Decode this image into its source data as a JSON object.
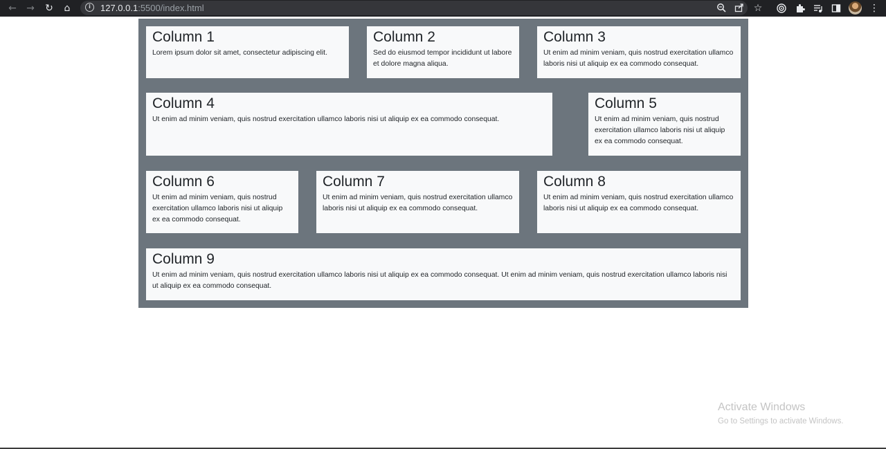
{
  "browser": {
    "url_host": "127.0.0.1",
    "url_rest": ":5500/index.html",
    "icons": [
      "back-arrow-icon",
      "forward-arrow-icon",
      "reload-icon",
      "home-icon",
      "site-info-icon",
      "zoom-icon",
      "share-icon",
      "bookmark-star-icon",
      "extension-target-icon",
      "extensions-puzzle-icon",
      "media-queue-icon",
      "side-panel-icon",
      "profile-avatar",
      "menu-kebab-icon"
    ]
  },
  "columns": [
    {
      "title": "Column 1",
      "text": "Lorem ipsum dolor sit amet, consectetur adipiscing elit."
    },
    {
      "title": "Column 2",
      "text": "Sed do eiusmod tempor incididunt ut labore et dolore magna aliqua."
    },
    {
      "title": "Column 3",
      "text": "Ut enim ad minim veniam, quis nostrud exercitation ullamco laboris nisi ut aliquip ex ea commodo consequat."
    },
    {
      "title": "Column 4",
      "text": "Ut enim ad minim veniam, quis nostrud exercitation ullamco laboris nisi ut aliquip ex ea commodo consequat."
    },
    {
      "title": "Column 5",
      "text": "Ut enim ad minim veniam, quis nostrud exercitation ullamco laboris nisi ut aliquip ex ea commodo consequat."
    },
    {
      "title": "Column 6",
      "text": "Ut enim ad minim veniam, quis nostrud exercitation ullamco laboris nisi ut aliquip ex ea commodo consequat."
    },
    {
      "title": "Column 7",
      "text": "Ut enim ad minim veniam, quis nostrud exercitation ullamco laboris nisi ut aliquip ex ea commodo consequat."
    },
    {
      "title": "Column 8",
      "text": "Ut enim ad minim veniam, quis nostrud exercitation ullamco laboris nisi ut aliquip ex ea commodo consequat."
    },
    {
      "title": "Column 9",
      "text": "Ut enim ad minim veniam, quis nostrud exercitation ullamco laboris nisi ut aliquip ex ea commodo consequat. Ut enim ad minim veniam, quis nostrud exercitation ullamco laboris nisi ut aliquip ex ea commodo consequat."
    }
  ],
  "watermark": {
    "title": "Activate Windows",
    "subtitle": "Go to Settings to activate Windows."
  },
  "colors": {
    "container_bg": "#6c757d",
    "card_bg": "#f8f9fa",
    "toolbar_bg": "#202124"
  }
}
